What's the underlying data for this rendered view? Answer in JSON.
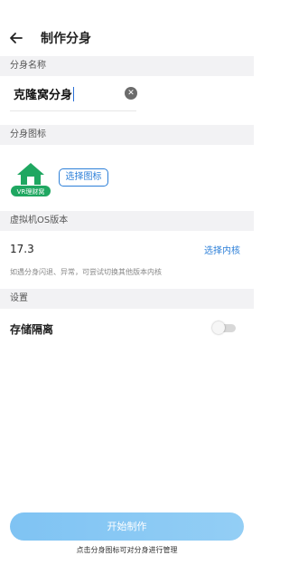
{
  "header": {
    "title": "制作分身"
  },
  "sections": {
    "name": "分身名称",
    "icon": "分身图标",
    "os": "虚拟机OS版本",
    "settings": "设置"
  },
  "name_field": {
    "value": "克隆窝分身"
  },
  "icon_picker": {
    "badge_text": "VR理财窝",
    "choose_label": "选择图标"
  },
  "os_version": {
    "value": "17.3",
    "choose_label": "选择内核",
    "hint": "如遇分身闪退、异常，可尝试切换其他版本内核"
  },
  "settings": {
    "storage_label": "存储隔离",
    "storage_enabled": false
  },
  "actions": {
    "start_label": "开始制作",
    "footer_hint": "点击分身图标可对分身进行管理"
  },
  "colors": {
    "accent": "#2c7fd8",
    "button": "#87c7f4",
    "logo_green": "#1fa761"
  }
}
